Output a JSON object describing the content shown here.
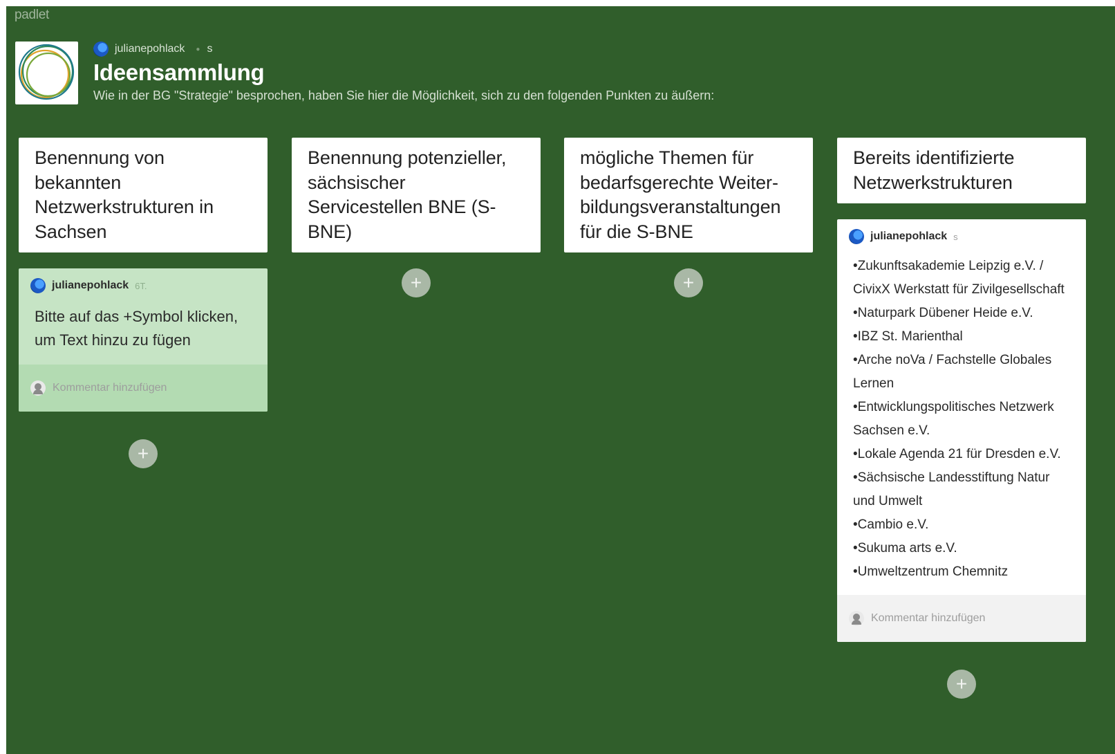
{
  "brand": "padlet",
  "header": {
    "author": "julianepohlack",
    "time": "s",
    "title": "Ideensammlung",
    "description": "Wie in der BG \"Strategie\" besprochen, haben Sie hier die Möglichkeit, sich zu den folgenden Punkten zu äußern:"
  },
  "columns": [
    {
      "title": "Benennung von bekannten Netzwerkstrukturen in Sachsen",
      "posts": [
        {
          "author": "julianepohlack",
          "time": "6T.",
          "body": "Bitte auf das +Symbol klicken, um Text hinzu zu fügen",
          "comment_placeholder": "Kommentar hinzufügen"
        }
      ]
    },
    {
      "title": "Benennung potenzieller, sächsischer Servicestellen BNE (S-BNE)",
      "posts": []
    },
    {
      "title": "mögliche Themen für bedarfsgerechte Weiter-bildungsveranstaltungen für die S-BNE",
      "posts": []
    },
    {
      "title": "Bereits identifizierte Netzwerkstrukturen",
      "posts": [
        {
          "author": "julianepohlack",
          "time": "s",
          "items": [
            "•Zukunftsakademie Leipzig e.V. / CivixX Werkstatt für Zivilgesellschaft",
            "•Naturpark Dübener Heide e.V.",
            "•IBZ St. Marienthal",
            "•Arche noVa / Fachstelle Globales Lernen",
            "•Entwicklungspolitisches Netzwerk Sachsen e.V.",
            "•Lokale Agenda 21 für Dresden e.V.",
            "•Sächsische Landesstiftung Natur und Umwelt",
            "•Cambio e.V.",
            "•Sukuma arts e.V.",
            "•Umweltzentrum Chemnitz"
          ],
          "comment_placeholder": "Kommentar hinzufügen"
        }
      ]
    }
  ],
  "add_symbol": "+",
  "colors": {
    "background": "#305e2b",
    "column_header": "#ffffff",
    "highlight_post": "#c6e4c5",
    "add_button": "#a9b8a6"
  },
  "icons": [
    "board-logo-icon",
    "avatar-icon",
    "plus-icon",
    "comment-avatar-icon"
  ]
}
